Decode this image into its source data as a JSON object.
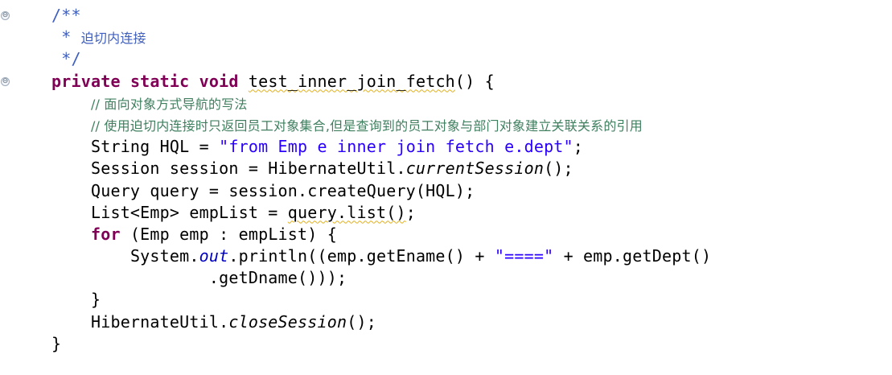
{
  "gutter": {
    "fold_marks": [
      "⊖",
      "⊖"
    ]
  },
  "code": {
    "javadoc_open": "/**",
    "javadoc_star": " * ",
    "javadoc_text": "迫切内连接",
    "javadoc_close": " */",
    "kw_private": "private",
    "kw_static": "static",
    "kw_void": "void",
    "method_name": "test_inner_join_fetch",
    "method_sig_rest": "() {",
    "comment1": "// 面向对象方式导航的写法",
    "comment2": "// 使用迫切内连接时只返回员工对象集合,但是查询到的员工对象与部门对象建立关联关系的引用",
    "hql_decl": "String HQL = ",
    "hql_string": "\"from Emp e inner join fetch e.dept\"",
    "semi": ";",
    "session_decl": "Session session = HibernateUtil.",
    "current_session": "currentSession",
    "call_end": "();",
    "query_line": "Query query = session.createQuery(HQL);",
    "list_decl": "List<Emp> empList = ",
    "query_list": "query.list()",
    "kw_for": "for",
    "for_rest": " (Emp emp : empList) {",
    "sysout_start": "System.",
    "out_field": "out",
    "println_part": ".println((emp.getEname() + ",
    "equals_string": "\"====\"",
    "println_rest": " + emp.getDept()",
    "get_dname": ".getDname()));",
    "close_brace_inner": "}",
    "hibernate_util": "HibernateUtil.",
    "close_session": "closeSession",
    "close_brace_outer": "}"
  }
}
